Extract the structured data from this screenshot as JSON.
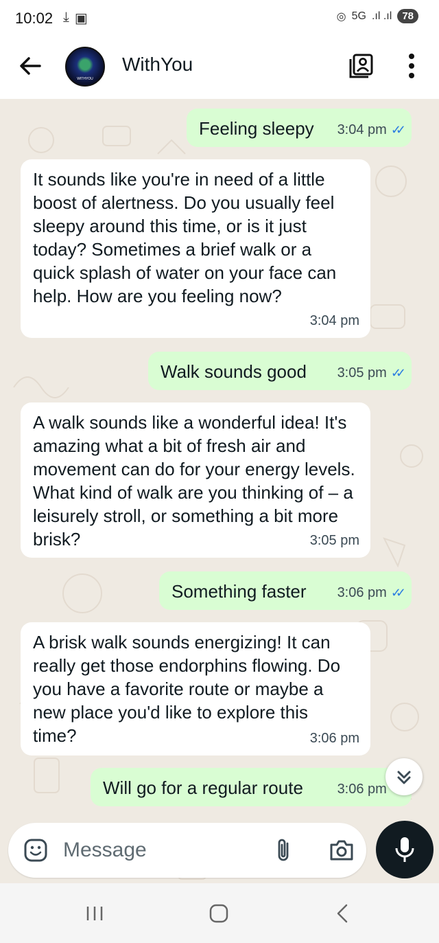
{
  "status_bar": {
    "time": "10:02",
    "network": "5G",
    "battery": "78",
    "icons": [
      "download-icon",
      "screenshot-icon",
      "hotspot-icon",
      "signal-icon"
    ]
  },
  "header": {
    "contact_name": "WithYou",
    "avatar_text": "WITHYOU",
    "icons": [
      "back-arrow-icon",
      "contact-card-icon",
      "more-vert-icon"
    ]
  },
  "messages": [
    {
      "direction": "out",
      "text": "Feeling sleepy",
      "time": "3:04 pm",
      "read": true
    },
    {
      "direction": "in",
      "text": "It sounds like you're in need of a little boost of alertness. Do you usually feel sleepy around this time, or is it just today? Sometimes a brief walk or a quick splash of water on your face can help. How are you feeling now?",
      "time": "3:04 pm"
    },
    {
      "direction": "out",
      "text": "Walk sounds good",
      "time": "3:05 pm",
      "read": true
    },
    {
      "direction": "in",
      "text": "A walk sounds like a wonderful idea! It's amazing what a bit of fresh air and movement can do for your energy levels. What kind of walk are you thinking of – a leisurely stroll, or something a bit more brisk?",
      "time": "3:05 pm"
    },
    {
      "direction": "out",
      "text": "Something faster",
      "time": "3:06 pm",
      "read": true
    },
    {
      "direction": "in",
      "text": "A brisk walk sounds energizing! It can really get those endorphins flowing. Do you have a favorite route or maybe a new place you'd like to explore this time?",
      "time": "3:06 pm"
    },
    {
      "direction": "out",
      "text": "Will go for a regular route",
      "time": "3:06 pm",
      "read": true
    }
  ],
  "composer": {
    "placeholder": "Message",
    "icons": [
      "emoji-icon",
      "attach-icon",
      "camera-icon",
      "mic-icon"
    ]
  },
  "colors": {
    "chat_background": "#efeae2",
    "outgoing_bubble": "#d9fdd3",
    "incoming_bubble": "#ffffff",
    "read_ticks": "#2a7de1",
    "mic_button": "#111b21"
  }
}
